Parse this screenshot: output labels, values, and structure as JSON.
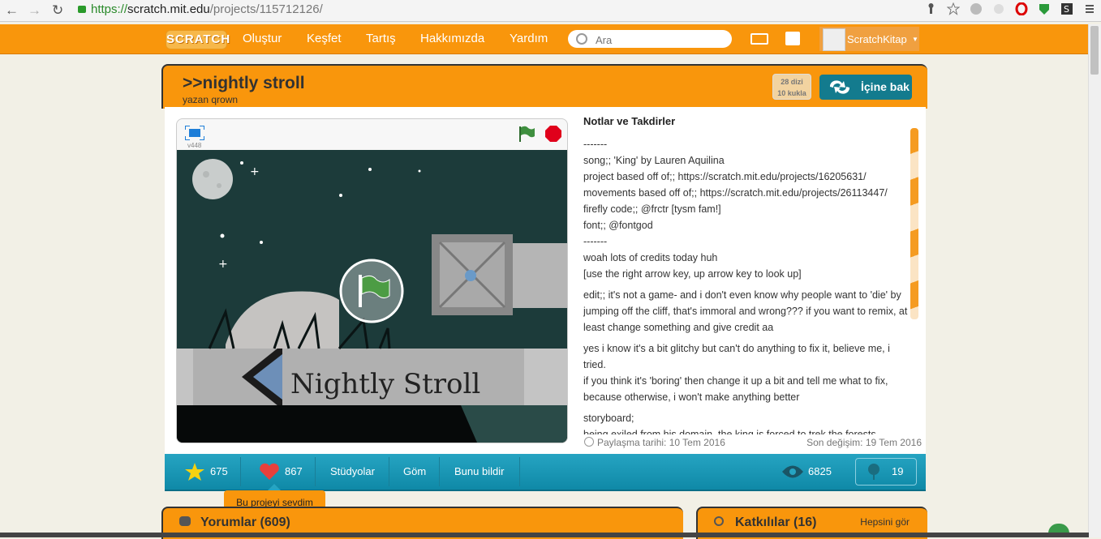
{
  "browser": {
    "url_https": "https://",
    "url_host": "scratch.mit.edu",
    "url_path": "/projects/115712126/"
  },
  "header": {
    "logo": "SCRATCH",
    "menu": [
      "Oluştur",
      "Keşfet",
      "Tartış",
      "Hakkımızda",
      "Yardım"
    ],
    "search_placeholder": "Ara",
    "username": "ScratchKitap"
  },
  "project": {
    "title": ">>nightly stroll",
    "author": "yazan qrown",
    "studios_count": "28 dizi",
    "sprites_count": "10 kukla",
    "see_inside": "İçine bak",
    "version": "v448"
  },
  "stage": {
    "banner_text": "Nightly Stroll"
  },
  "notes": {
    "title": "Notlar ve Takdirler",
    "lines": [
      "-------",
      "song;; 'King' by Lauren Aquilina",
      "project based off of;; https://scratch.mit.edu/projects/16205631/",
      "movements based off of;; https://scratch.mit.edu/projects/26113447/",
      "firefly code;; @frctr [tysm fam!]",
      "font;; @fontgod",
      "-------",
      "woah lots of credits today huh",
      "[use the right arrow key, up arrow key to look up]"
    ],
    "paragraphs": [
      "edit;; it's not a game- and i don't even know why people want to 'die' by jumping off the cliff, that's immoral and wrong??? if you want to remix, at least change something and give credit aa",
      "yes i know it's a bit glitchy but can't do anything to fix it, believe me, i tried.",
      "if you think it's 'boring' then change it up a bit and tell me what to fix, because otherwise, i won't make anything better",
      "storyboard;",
      "being exiled from his domain, the king is forced to trek the forests"
    ],
    "shared": "Paylaşma tarihi: 10 Tem 2016",
    "modified": "Son değişim: 19 Tem 2016"
  },
  "stats": {
    "favorites": "675",
    "loves": "867",
    "studios_label": "Stüdyolar",
    "embed_label": "Göm",
    "report_label": "Bunu bildir",
    "views": "6825",
    "remixes": "19"
  },
  "tooltip": "Bu projeyi sevdim",
  "comments": {
    "title": "Yorumlar (609)"
  },
  "credits": {
    "title": "Katkılılar (16)",
    "see_all": "Hepsini gör"
  },
  "colors": {
    "brand_orange": "#f9960c",
    "stats_teal": "#1a97b5",
    "see_inside": "#137b8e"
  }
}
